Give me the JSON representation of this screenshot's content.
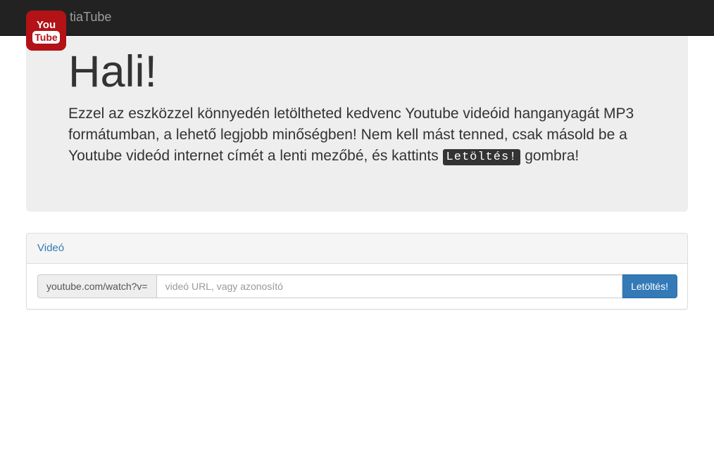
{
  "navbar": {
    "brand": "tiaTube",
    "logo": {
      "icon": "youtube-logo-icon",
      "text_top": "You",
      "text_bottom": "Tube",
      "color": "#b31217"
    }
  },
  "jumbotron": {
    "title": "Hali!",
    "lead_before": "Ezzel az eszközzel könnyedén letöltheted kedvenc Youtube videóid hanganyagát MP3 formátumban, a lehető legjobb minőségben! Nem kell mást tenned, csak másold be a Youtube videód internet címét a lenti mezőbé, és kattints ",
    "lead_kbd": "Letöltés!",
    "lead_after": " gombra!"
  },
  "panel": {
    "heading": "Videó",
    "addon": "youtube.com/watch?v=",
    "input_value": "",
    "input_placeholder": "videó URL, vagy azonosító",
    "button_label": "Letöltés!"
  },
  "colors": {
    "navbar_bg": "#222222",
    "jumbotron_bg": "#eeeeee",
    "link": "#337ab7",
    "button": "#337ab7"
  }
}
